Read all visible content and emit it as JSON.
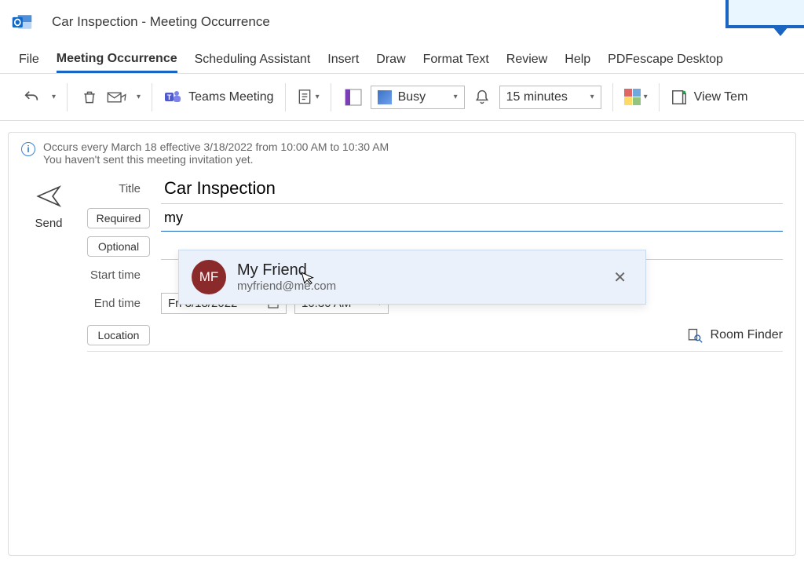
{
  "window": {
    "title_subject": "Car Inspection",
    "title_sep": "  -  ",
    "title_type": "Meeting Occurrence"
  },
  "tabs": {
    "file": "File",
    "meeting": "Meeting Occurrence",
    "scheduling": "Scheduling Assistant",
    "insert": "Insert",
    "draw": "Draw",
    "format": "Format Text",
    "review": "Review",
    "help": "Help",
    "pdfescape": "PDFescape Desktop"
  },
  "toolbar": {
    "teams": "Teams Meeting",
    "status_label": "Busy",
    "reminder_label": "15 minutes",
    "view_templates": "View Tem"
  },
  "info": {
    "recurrence": "Occurs every March 18 effective 3/18/2022 from 10:00 AM to 10:30 AM",
    "not_sent": "You haven't sent this meeting invitation yet."
  },
  "form": {
    "send": "Send",
    "title_label": "Title",
    "title_value": "Car Inspection",
    "required_label": "Required",
    "required_value": "my",
    "optional_label": "Optional",
    "start_label": "Start time",
    "end_label": "End time",
    "end_date": "Fri 3/18/2022",
    "end_time": "10:30 AM",
    "location_label": "Location",
    "room_finder": "Room Finder"
  },
  "autocomplete": {
    "initials": "MF",
    "name": "My Friend",
    "email": "myfriend@me.com"
  }
}
